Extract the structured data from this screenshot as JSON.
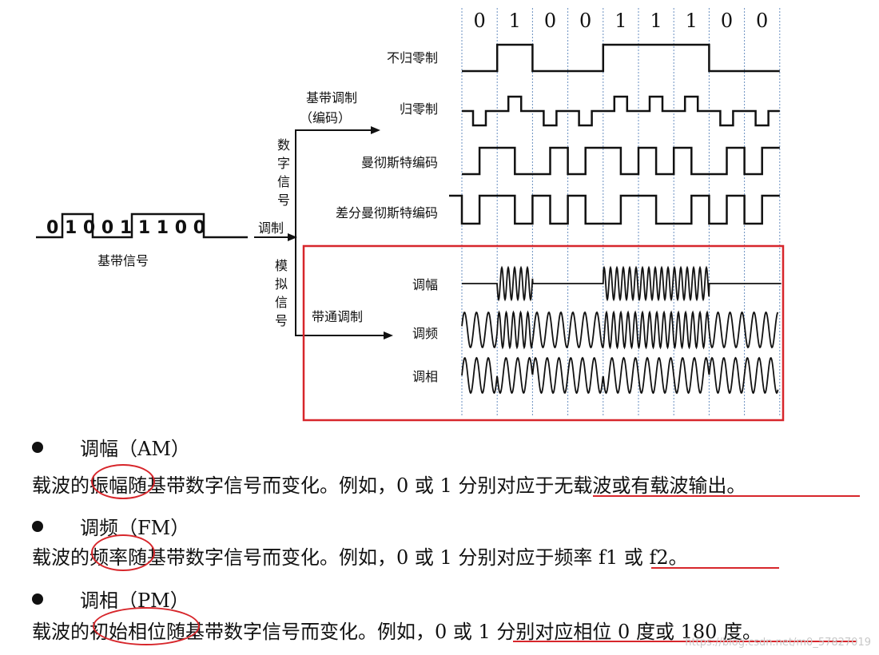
{
  "diagram": {
    "top_bits": [
      "0",
      "1",
      "0",
      "0",
      "1",
      "1",
      "1",
      "0",
      "0"
    ],
    "baseband_bits": "0 1 0 0 1 1 1 0 0",
    "baseband_label": "基带信号",
    "modulation_label": "调制",
    "digital_signal_chars": [
      "数",
      "字",
      "信",
      "号"
    ],
    "analog_signal_chars": [
      "模",
      "拟",
      "信",
      "号"
    ],
    "baseband_modulation_label": "基带调制",
    "encoding_label": "（编码）",
    "bandpass_modulation_label": "带通调制",
    "rows": {
      "nrz": "不归零制",
      "rz": "归零制",
      "manchester": "曼彻斯特编码",
      "diff_manchester": "差分曼彻斯特编码",
      "am": "调幅",
      "fm": "调频",
      "pm": "调相"
    }
  },
  "notes": {
    "am_title": "调幅（AM）",
    "am_text": "载波的振幅随基带数字信号而变化。例如，0 或 1 分别对应于无载波或有载波输出。",
    "fm_title": "调频（FM）",
    "fm_text": "载波的频率随基带数字信号而变化。例如，0 或 1 分别对应于频率 f1 或 f2。",
    "pm_title": "调相（PM）",
    "pm_text": "载波的初始相位随基带数字信号而变化。例如，0 或 1 分别对应相位 0 度或 180 度。"
  },
  "watermark": "https://blog.csdn.net/m0_57827019",
  "colors": {
    "accent_red": "#d7262b",
    "grid_blue": "#6a8fc0"
  }
}
